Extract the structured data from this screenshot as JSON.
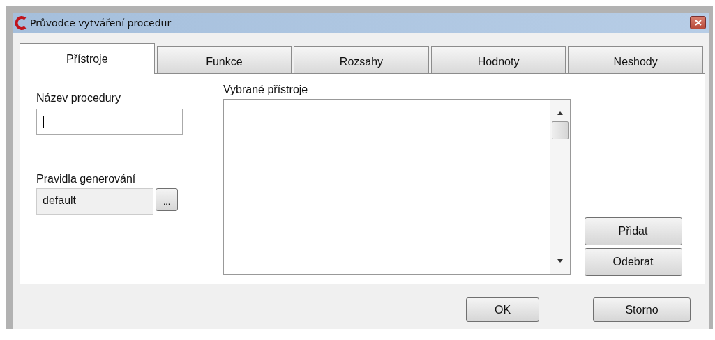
{
  "window": {
    "title": "Průvodce vytváření procedur"
  },
  "tabs": [
    {
      "label": "Přístroje",
      "selected": true
    },
    {
      "label": "Funkce",
      "selected": false
    },
    {
      "label": "Rozsahy",
      "selected": false
    },
    {
      "label": "Hodnoty",
      "selected": false
    },
    {
      "label": "Neshody",
      "selected": false
    }
  ],
  "procedure_name": {
    "label": "Název procedury",
    "focused": true
  },
  "generation_rules": {
    "label": "Pravidla generování",
    "value": "default",
    "browse_button": "..."
  },
  "selected_instruments": {
    "label": "Vybrané přístroje"
  },
  "side_buttons": [
    "Přidat",
    "Odebrat"
  ],
  "buttons": [
    "OK",
    "Storno"
  ]
}
